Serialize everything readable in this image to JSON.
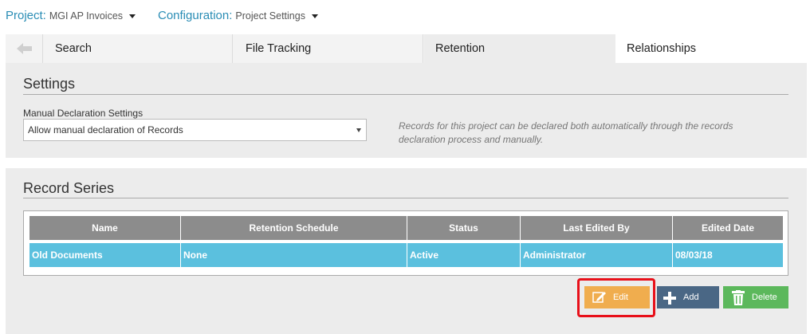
{
  "header": {
    "project_label": "Project:",
    "project_value": "MGI AP Invoices",
    "config_label": "Configuration:",
    "config_value": "Project Settings"
  },
  "tabs": [
    {
      "label": "Search"
    },
    {
      "label": "File Tracking"
    },
    {
      "label": "Retention"
    },
    {
      "label": "Relationships"
    }
  ],
  "settings": {
    "title": "Settings",
    "field_label": "Manual Declaration Settings",
    "selected_value": "Allow manual declaration of Records",
    "help_text": "Records for this project can be declared both automatically through the records declaration process and manually."
  },
  "record_series": {
    "title": "Record Series",
    "columns": [
      "Name",
      "Retention Schedule",
      "Status",
      "Last Edited By",
      "Edited Date"
    ],
    "rows": [
      [
        "Old Documents",
        "None",
        "Active",
        "Administrator",
        "08/03/18"
      ]
    ]
  },
  "buttons": {
    "edit": "Edit",
    "add": "Add",
    "delete": "Delete"
  },
  "colors": {
    "edit": "#f0ad4e",
    "add": "#4a6785",
    "delete": "#5cb85c",
    "row_selected": "#5bc0de",
    "highlight": "#e8101a"
  }
}
